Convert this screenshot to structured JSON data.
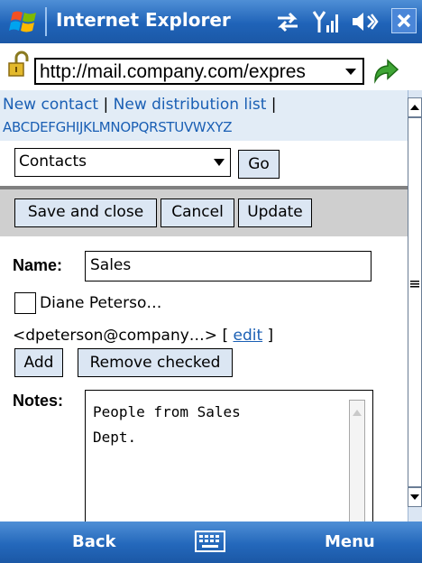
{
  "titlebar": {
    "title": "Internet Explorer",
    "icons": [
      "windows-logo-icon",
      "sync-arrows-icon",
      "signal-icon",
      "volume-icon",
      "close-icon"
    ]
  },
  "addressbar": {
    "url": "http://mail.company.com/expres"
  },
  "links": {
    "new_contact": "New contact",
    "separator": "|",
    "new_distribution_list": "New distribution list",
    "trailing_separator": "|",
    "alphabet": "ABCDEFGHIJKLMNOPQRSTUVWXYZ"
  },
  "folder": {
    "selected": "Contacts",
    "go_label": "Go"
  },
  "actions": {
    "save_and_close": "Save and close",
    "cancel": "Cancel",
    "update": "Update"
  },
  "form": {
    "name_label": "Name:",
    "name_value": "Sales",
    "member_name": "Diane Peterso…",
    "member_email": "<dpeterson@company…>",
    "edit_open": "[",
    "edit_label": "edit",
    "edit_close": "]",
    "add_label": "Add",
    "remove_checked_label": "Remove checked",
    "notes_label": "Notes:",
    "notes_value": "People from Sales\nDept."
  },
  "softkeys": {
    "back": "Back",
    "menu": "Menu"
  },
  "colors": {
    "titlebar": "#1f63b8",
    "link": "#1a5fb4",
    "button_bg": "#dbe6f3",
    "links_band": "#e2ecf6",
    "action_band": "#cfcfcf"
  }
}
